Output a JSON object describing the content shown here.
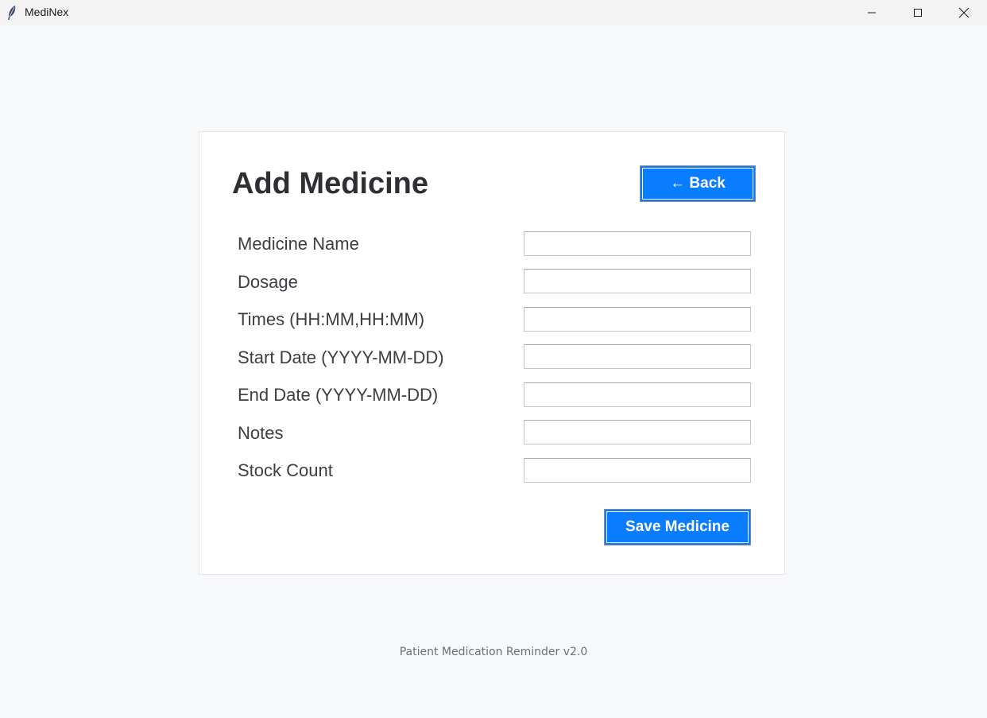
{
  "window": {
    "title": "MediNex",
    "minimize_icon": "minimize-icon",
    "maximize_icon": "maximize-icon",
    "close_icon": "close-icon"
  },
  "form": {
    "title": "Add Medicine",
    "back_label": "← Back",
    "save_label": "Save Medicine",
    "fields": [
      {
        "label": "Medicine Name",
        "value": ""
      },
      {
        "label": "Dosage",
        "value": ""
      },
      {
        "label": "Times (HH:MM,HH:MM)",
        "value": ""
      },
      {
        "label": "Start Date (YYYY-MM-DD)",
        "value": ""
      },
      {
        "label": "End Date (YYYY-MM-DD)",
        "value": ""
      },
      {
        "label": "Notes",
        "value": ""
      },
      {
        "label": "Stock Count",
        "value": ""
      }
    ]
  },
  "footer": {
    "text": "Patient Medication Reminder v2.0"
  },
  "colors": {
    "accent": "#0a7cff",
    "background": "#f7f8fa",
    "card": "#ffffff",
    "title_text": "#2d2f33"
  }
}
